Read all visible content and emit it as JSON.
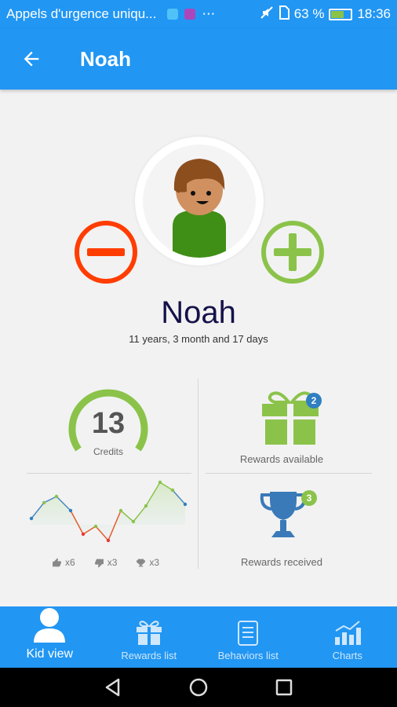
{
  "status_bar": {
    "notification": "Appels d'urgence uniqu...",
    "dots": "⋯",
    "battery": "63 %",
    "time": "18:36"
  },
  "app_bar": {
    "title": "Noah"
  },
  "profile": {
    "name": "Noah",
    "age": "11 years, 3 month and 17 days"
  },
  "stats": {
    "credits_value": "13",
    "credits_label": "Credits",
    "rewards_available_count": "2",
    "rewards_available_label": "Rewards available",
    "rewards_received_count": "3",
    "rewards_received_label": "Rewards received",
    "thumbs_up": "x6",
    "thumbs_down": "x3",
    "trophies": "x3"
  },
  "nav": {
    "items": [
      {
        "label": "Kid view",
        "active": true
      },
      {
        "label": "Rewards list",
        "active": false
      },
      {
        "label": "Behaviors list",
        "active": false
      },
      {
        "label": "Charts",
        "active": false
      }
    ]
  },
  "colors": {
    "primary": "#2196f3",
    "minus": "#ff3d00",
    "plus": "#8bc34a",
    "name": "#14124a"
  }
}
